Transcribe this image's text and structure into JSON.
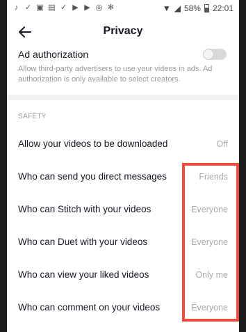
{
  "status_bar": {
    "battery": "58%",
    "time": "22:01"
  },
  "header": {
    "title": "Privacy"
  },
  "ad_authorization": {
    "title": "Ad authorization",
    "description": "Allow third-party advertisers to use your videos in ads. Ad authorization is only available to select creators.",
    "enabled": false
  },
  "safety": {
    "section_label": "SAFETY",
    "items": [
      {
        "label": "Allow your videos to be downloaded",
        "value": "Off"
      },
      {
        "label": "Who can send you direct messages",
        "value": "Friends"
      },
      {
        "label": "Who can Stitch with your videos",
        "value": "Everyone"
      },
      {
        "label": "Who can Duet with your videos",
        "value": "Everyone"
      },
      {
        "label": "Who can view your liked videos",
        "value": "Only me"
      },
      {
        "label": "Who can comment on your videos",
        "value": "Everyone"
      }
    ]
  },
  "colors": {
    "highlight_box": "#ee4b40",
    "secondary_text": "#999999",
    "primary_text": "#161823"
  }
}
